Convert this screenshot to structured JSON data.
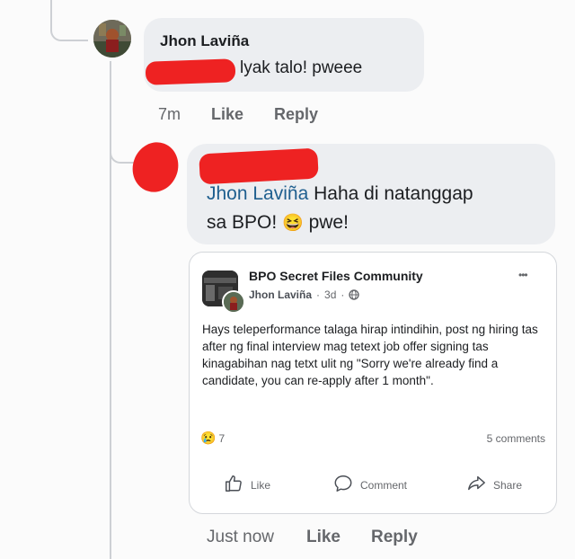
{
  "comment1": {
    "author": "Jhon Laviña",
    "text": "lyak talo! pweee",
    "time": "7m",
    "like_label": "Like",
    "reply_label": "Reply"
  },
  "comment2": {
    "mention": "Jhon Laviña",
    "text_line1": "Haha di natanggap",
    "text_line2_a": "sa BPO!",
    "emoji": "😆",
    "text_line2_b": "pwe!",
    "time": "Just now",
    "like_label": "Like",
    "reply_label": "Reply"
  },
  "shared_post": {
    "group_name": "BPO Secret Files Community",
    "author": "Jhon Laviña",
    "separator": "·",
    "time": "3d",
    "more_label": "•••",
    "body": "Hays teleperformance talaga hirap intindihin, post ng hiring tas after ng final interview mag tetext job offer signing tas kinagabihan nag tetxt ulit ng \"Sorry we're already find a candidate, you can re-apply after 1 month\".",
    "reaction_emoji": "😢",
    "reaction_count": "7",
    "comments_count": "5 comments",
    "actions": {
      "like": "Like",
      "comment": "Comment",
      "share": "Share"
    }
  },
  "colors": {
    "bubble": "#eceef1",
    "mention": "#1f5f8f",
    "meta": "#65676b",
    "redaction": "#ee2222"
  },
  "icons": [
    "globe-icon",
    "thumbs-up-icon",
    "comment-icon",
    "share-icon",
    "more-icon"
  ]
}
